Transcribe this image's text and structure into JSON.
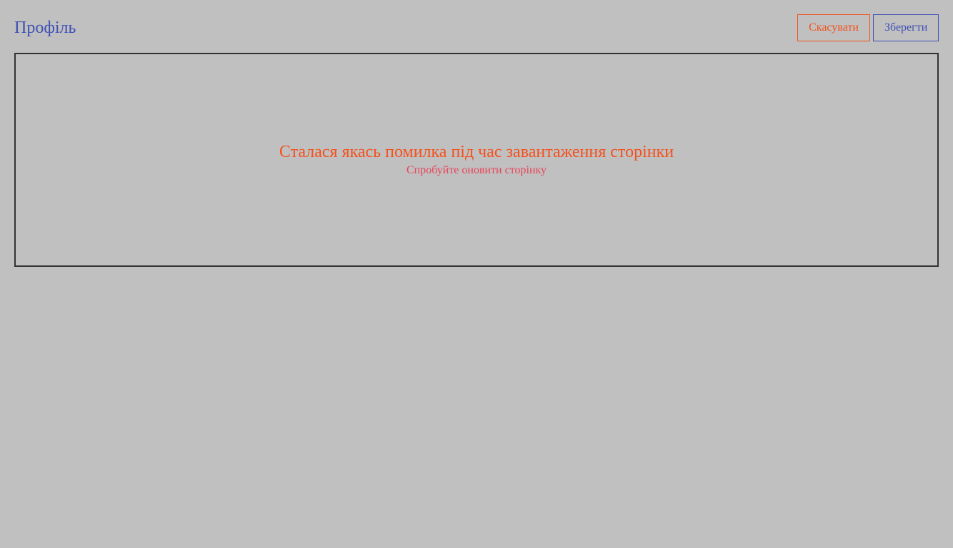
{
  "header": {
    "title": "Профіль",
    "cancel_label": "Скасувати",
    "save_label": "Зберегти"
  },
  "error": {
    "message": "Сталася якась помилка під час завантаження сторінки",
    "hint": "Спробуйте оновити сторінку"
  },
  "colors": {
    "background": "#c0c0c0",
    "primary": "#3f51b5",
    "danger": "#f4511e",
    "hint": "#e8445a",
    "border": "#333333"
  }
}
